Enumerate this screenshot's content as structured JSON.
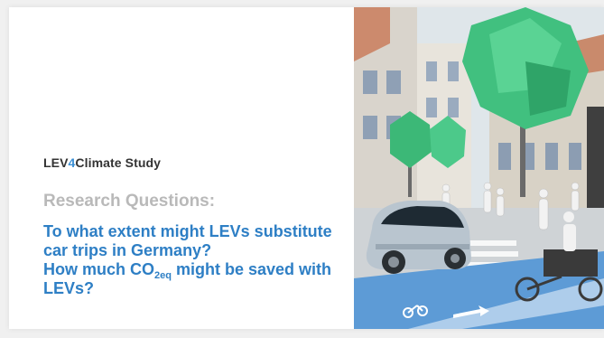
{
  "slide": {
    "study_prefix": "LEV",
    "study_accent": "4",
    "study_suffix": "Climate Study",
    "research_heading": "Research Questions:",
    "question1": "To what extent might LEVs substitute car trips in Germany?",
    "question2_prefix": "How much CO",
    "question2_sub": "2eq",
    "question2_suffix": " might be saved with LEVs?"
  },
  "illustration": {
    "icons": [
      "tree-icon",
      "car-icon",
      "cargo-bike-icon",
      "pedestrian-icon",
      "building-icon",
      "bike-lane-symbol-icon"
    ]
  },
  "colors": {
    "accent": "#3b8fd4",
    "question": "#2e7fc5",
    "heading_gray": "#b9b9b9",
    "tree_green": "#3fbf7f"
  }
}
